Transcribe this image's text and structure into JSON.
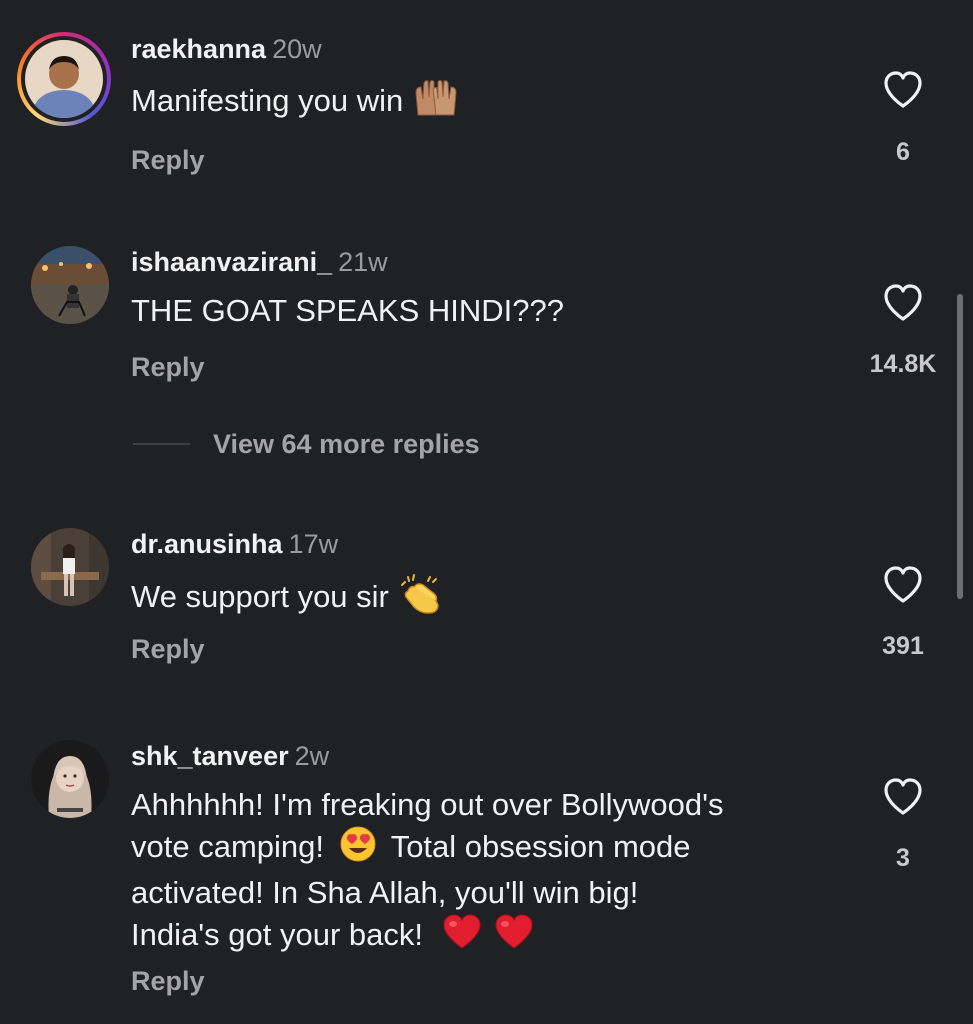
{
  "comments": [
    {
      "username": "raekhanna",
      "time": "20w",
      "text": "Manifesting you win",
      "emoji": "raising-hands",
      "reply_label": "Reply",
      "likes": "6"
    },
    {
      "username": "ishaanvazirani_",
      "time": "21w",
      "text": "THE GOAT SPEAKS HINDI???",
      "reply_label": "Reply",
      "likes": "14.8K",
      "view_more": "View 64 more replies"
    },
    {
      "username": "dr.anusinha",
      "time": "17w",
      "text": "We support you sir",
      "emoji": "clapping-hands",
      "reply_label": "Reply",
      "likes": "391"
    },
    {
      "username": "shk_tanveer",
      "time": "2w",
      "text_line1": "Ahhhhhh! I'm freaking out over Bollywood's",
      "text_line2a": "vote camping!",
      "text_line2b": "Total obsession mode",
      "text_line3": "activated! In Sha Allah, you'll win big!",
      "text_line4": "India's got your back!",
      "reply_label": "Reply",
      "likes": "3"
    }
  ],
  "colors": {
    "background": "#202125",
    "text": "#f2f2f2",
    "secondary": "#a3a3a8"
  }
}
